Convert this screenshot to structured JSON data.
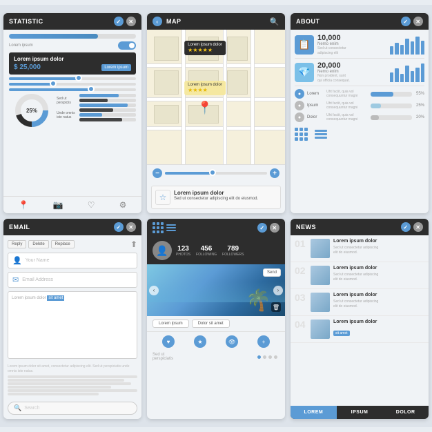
{
  "widgets": {
    "statistic": {
      "title": "STATISTIC",
      "progress1": 70,
      "progress2": 45,
      "progress3": 60,
      "toggle_label": "Lorem ipsum",
      "big_title": "Lorem ipsum dolor",
      "price": "$ 25,000",
      "btn_label": "Lorem ipsum",
      "pie_percent": "25%",
      "bar1_label": "Sed ut perspiciis",
      "bar2_label": "Unde omnis iste natus",
      "icons": [
        "📍",
        "📷",
        "♡",
        "⚙"
      ]
    },
    "map": {
      "title": "MAP",
      "balloon1": "Lorem ipsum dolor",
      "stars1": "★★★★★",
      "balloon2": "Lorem ipsum dolor",
      "stars2": "★★★★",
      "info_title": "Lorem ipsum dolor",
      "info_text": "Sed ut consectetur adipiscing elit do eiusmod."
    },
    "about": {
      "title": "ABOUT",
      "item1_num": "10,000",
      "item1_name": "Nemo enim",
      "item1_desc": "Sed ut consectetur\nadipiscing elit",
      "item2_num": "20,000",
      "item2_name": "Nemo enim",
      "item2_desc": "Non proident, sunt in culpa\nqui officia consequat.",
      "prog1_name": "Lorem",
      "prog1_val": 55,
      "prog1_label": "55%",
      "prog2_name": "Ipsum",
      "prog2_val": 25,
      "prog2_label": "25%",
      "prog3_name": "Dolor",
      "prog3_val": 20,
      "prog3_label": "20%"
    },
    "email": {
      "title": "EMAIL",
      "btn_reply": "Reply",
      "btn_delete": "Delete",
      "btn_replace": "Replace",
      "input1_placeholder": "Your Name",
      "input2_placeholder": "Email Address",
      "body_text": "Lorem ipsum dolor sit amet",
      "highlight": "sit amet",
      "footer_text": "Lorem ipsum dolor sit amet, consectetur adipiscing elit. Sed ut perspiciatis unde omnis iste natus error sit voluptatem accusantium doloremque.",
      "search_placeholder": "Search"
    },
    "social": {
      "title": "",
      "photos_num": "123",
      "photos_label": "PHOTOS",
      "following_num": "456",
      "following_label": "FOLLOWING",
      "followers_num": "789",
      "followers_label": "FOLLOWERS",
      "send_label": "Send",
      "text_btn1": "Lorem ipsum",
      "text_btn2": "Dolor sit amet",
      "caption": "Sed ut\nperspiciatis",
      "icons": [
        "♥",
        "★",
        "👁",
        "⊕"
      ]
    },
    "news": {
      "title": "NEWS",
      "items": [
        {
          "num": "01",
          "title": "Lorem ipsum dolor",
          "desc": "Sed ut consectetur adipiscing elit do eiusmod.",
          "tag": ""
        },
        {
          "num": "02",
          "title": "Lorem ipsum dolor",
          "desc": "Sed ut consectetur adipiscing elit do eiusmod.",
          "tag": ""
        },
        {
          "num": "03",
          "title": "Lorem ipsum dolor",
          "desc": "Sed ut consectetur adipiscing elit do eiusmod.",
          "tag": ""
        },
        {
          "num": "04",
          "title": "Lorem ipsum dolor",
          "desc": "sit amet",
          "tag": "sit amet"
        }
      ],
      "footer_btn1": "LOREM",
      "footer_btn2": "IPSUM",
      "footer_btn3": "DOLOR"
    }
  }
}
